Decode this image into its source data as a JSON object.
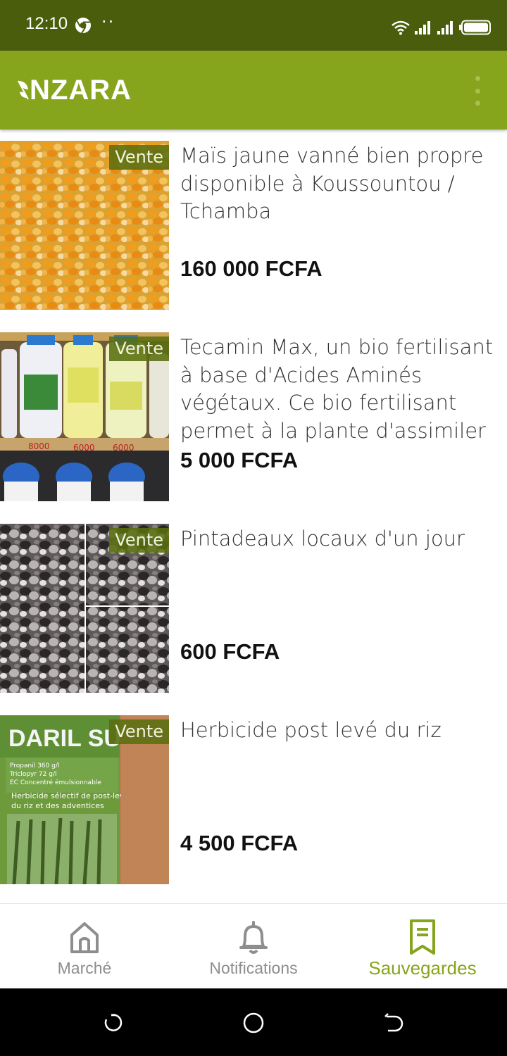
{
  "status_bar": {
    "time": "12:10",
    "dots": "··",
    "icons": [
      "chrome-icon",
      "wifi-icon",
      "signal-icon",
      "signal-icon",
      "battery-icon"
    ]
  },
  "app_bar": {
    "logo_text": "NZARA",
    "menu_icon": "overflow-menu-icon",
    "color": "#86a51c"
  },
  "listings": [
    {
      "badge": "Vente",
      "title": "Maïs jaune vanné bien propre disponible à Koussountou / Tchamba",
      "price": "160 000 FCFA",
      "image": "maize-kernels"
    },
    {
      "badge": "Vente",
      "title": "Tecamin Max, un bio fertilisant à base d'Acides Aminés végétaux. Ce bio fertilisant permet à la plante d'assimiler les éléments ...",
      "price": "5 000 FCFA",
      "image": "fertilizer-bottles"
    },
    {
      "badge": "Vente",
      "title": "Pintadeaux locaux d'un jour",
      "price": "600 FCFA",
      "image": "guinea-fowl-chicks"
    },
    {
      "badge": "Vente",
      "title": "Herbicide post levé du riz",
      "price": "4 500 FCFA",
      "image": "herbicide-container"
    }
  ],
  "bottom_nav": [
    {
      "label": "Marché",
      "icon": "home-icon",
      "active": false
    },
    {
      "label": "Notifications",
      "icon": "bell-icon",
      "active": false
    },
    {
      "label": "Sauvegardes",
      "icon": "bookmark-icon",
      "active": true
    }
  ],
  "system_nav": [
    "recents-icon",
    "home-circle-icon",
    "back-icon"
  ],
  "colors": {
    "status_bar": "#4a5d0c",
    "brand_green": "#86a51c",
    "badge_bg": "#5a6e0f",
    "inactive_nav": "#8e8e8e"
  }
}
